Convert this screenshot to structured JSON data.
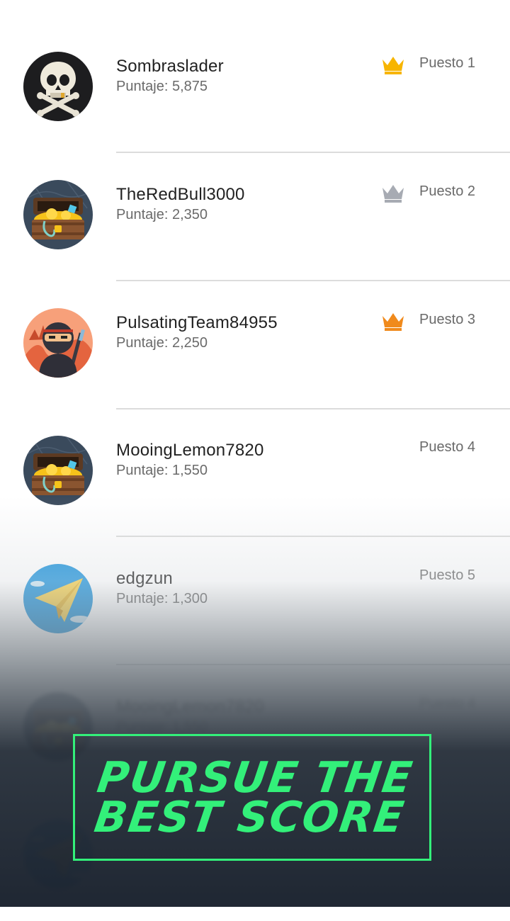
{
  "leaderboard": {
    "entries": [
      {
        "name": "Sombraslader",
        "score": "Puntaje: 5,875",
        "rank": "Puesto 1",
        "avatar": "skull-avatar",
        "crown": "gold-crown",
        "crown_color": "#F7B500"
      },
      {
        "name": "TheRedBull3000",
        "score": "Puntaje: 2,350",
        "rank": "Puesto 2",
        "avatar": "treasure-chest-avatar",
        "crown": "silver-crown",
        "crown_color": "#A7ABB3"
      },
      {
        "name": "PulsatingTeam84955",
        "score": "Puntaje: 2,250",
        "rank": "Puesto 3",
        "avatar": "ninja-avatar",
        "crown": "bronze-crown",
        "crown_color": "#F08A1C"
      },
      {
        "name": "MooingLemon7820",
        "score": "Puntaje: 1,550",
        "rank": "Puesto 4",
        "avatar": "treasure-chest-avatar"
      },
      {
        "name": "edgzun",
        "score": "Puntaje: 1,300",
        "rank": "Puesto 5",
        "avatar": "paper-plane-avatar"
      },
      {
        "name": "MooingLemon7820",
        "score": "Puntaje: 1,550",
        "rank": "Puesto 4",
        "avatar": "treasure-chest-avatar"
      }
    ]
  },
  "banner": {
    "line1": "PURSUE THE",
    "line2": "BEST SCORE",
    "accent_color": "#33F07A"
  }
}
